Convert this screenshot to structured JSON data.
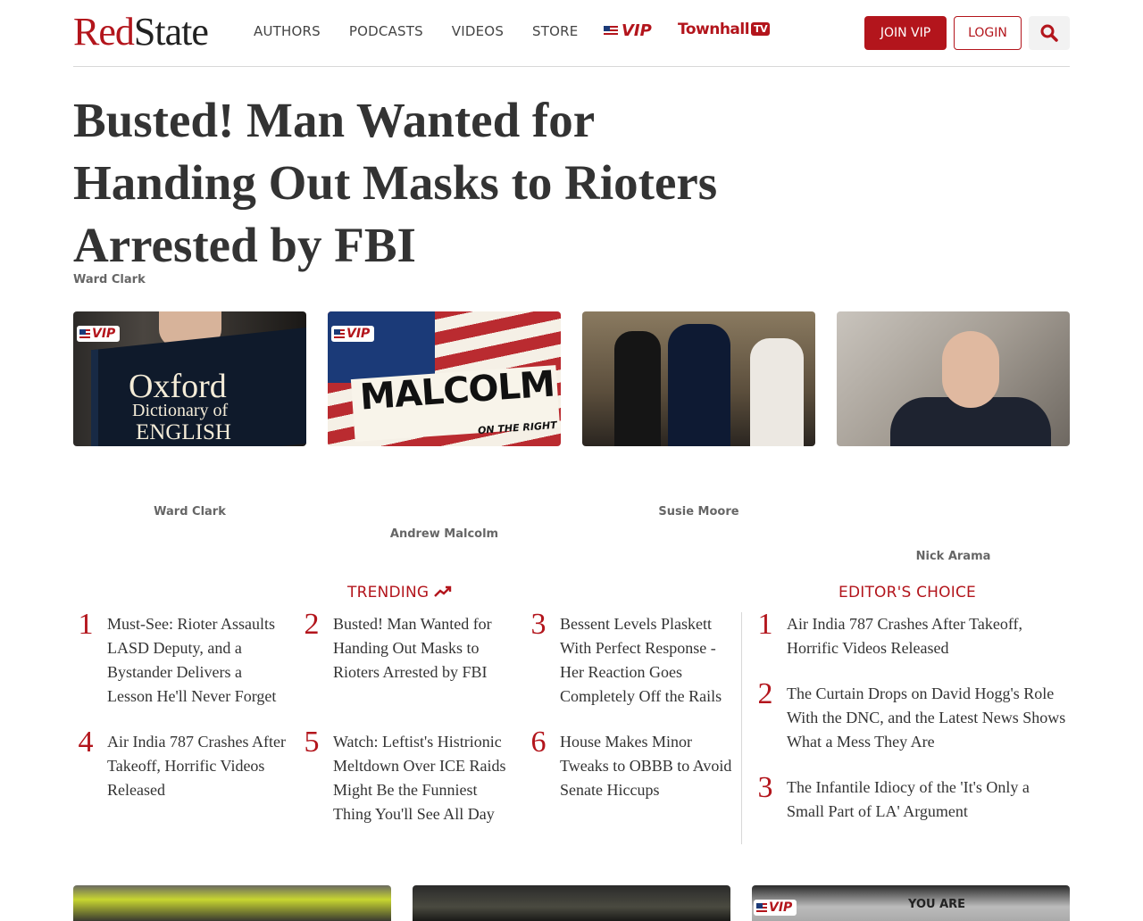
{
  "header": {
    "logo_red": "Red",
    "logo_dark": "State",
    "nav": [
      "AUTHORS",
      "PODCASTS",
      "VIDEOS",
      "STORE"
    ],
    "vip_label": "VIP",
    "townhall_label": "Townhall",
    "townhall_tv": "TV",
    "join_label": "JOIN VIP",
    "login_label": "LOGIN"
  },
  "article": {
    "headline": "Busted! Man Wanted for Handing Out Masks to Rioters Arrested by FBI",
    "author": "Ward Clark"
  },
  "cards": [
    {
      "vip": "VIP",
      "author": "Ward Clark",
      "image_text": [
        "Oxford",
        "Dictionary of",
        "ENGLISH"
      ]
    },
    {
      "vip": "VIP",
      "author": "Andrew Malcolm",
      "image_text": [
        "MALCOLM",
        "ON THE RIGHT"
      ]
    },
    {
      "author": "Susie Moore"
    },
    {
      "author": "Nick Arama"
    }
  ],
  "trending": {
    "title": "TRENDING",
    "items": [
      {
        "num": "1",
        "text": "Must-See: Rioter Assaults LASD Deputy, and a Bystander Delivers a Lesson He'll Never Forget"
      },
      {
        "num": "2",
        "text": "Busted! Man Wanted for Handing Out Masks to Rioters Arrested by FBI"
      },
      {
        "num": "3",
        "text": "Bessent Levels Plaskett With Perfect Response - Her Reaction Goes Completely Off the Rails"
      },
      {
        "num": "4",
        "text": "Air India 787 Crashes After Takeoff, Horrific Videos Released"
      },
      {
        "num": "5",
        "text": "Watch: Leftist's Histrionic Meltdown Over ICE Raids Might Be the Funniest Thing You'll See All Day"
      },
      {
        "num": "6",
        "text": "House Makes Minor Tweaks to OBBB to Avoid Senate Hiccups"
      }
    ]
  },
  "editors_choice": {
    "title": "EDITOR'S CHOICE",
    "items": [
      {
        "num": "1",
        "text": "Air India 787 Crashes After Takeoff, Horrific Videos Released"
      },
      {
        "num": "2",
        "text": "The Curtain Drops on David Hogg's Role With the DNC, and the Latest News Shows What a Mess They Are"
      },
      {
        "num": "3",
        "text": "The Infantile Idiocy of the 'It's Only a Small Part of LA' Argument"
      }
    ]
  },
  "bottom_cards": [
    {},
    {},
    {
      "vip": "VIP",
      "image_text": "YOU ARE"
    }
  ],
  "colors": {
    "brand": "#b3151c",
    "text": "#333333",
    "muted": "#666666"
  }
}
